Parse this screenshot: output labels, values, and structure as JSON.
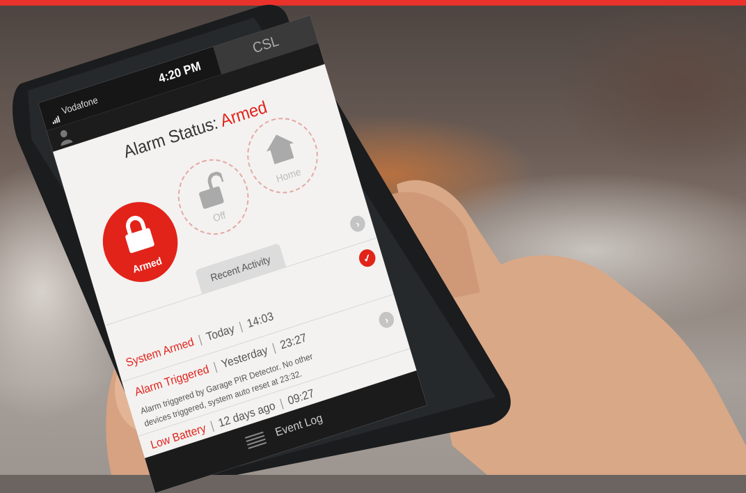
{
  "status_bar": {
    "carrier": "Vodafone",
    "time": "4:20 PM",
    "csl_tab": "CSL"
  },
  "header": {
    "title_prefix": "Alarm Status:",
    "title_value": "Armed"
  },
  "modes": [
    {
      "label": "Armed",
      "state": "active"
    },
    {
      "label": "Off",
      "state": "inactive"
    },
    {
      "label": "Home",
      "state": "inactive"
    }
  ],
  "recent_tab": "Recent Activity",
  "activity": [
    {
      "title": "System Armed",
      "day": "Today",
      "time": "14:03",
      "description": ""
    },
    {
      "title": "Alarm Triggered",
      "day": "Yesterday",
      "time": "23:27",
      "description": "Alarm triggered by Garage PIR Detector. No other devices triggered, system auto reset at 23:32."
    },
    {
      "title": "Low Battery",
      "day": "12 days ago",
      "time": "09:27",
      "description": ""
    }
  ],
  "footer": {
    "event_log": "Event Log"
  },
  "colors": {
    "accent": "#e2231a",
    "top_bar": "#e8322b",
    "phone_body": "#1a1c1e",
    "skin": "#d9a887"
  },
  "icons": [
    "signal-icon",
    "battery-icon",
    "user-icon",
    "padlock-icon",
    "unlock-icon",
    "house-icon",
    "chevron-right-icon",
    "check-icon",
    "menu-icon"
  ]
}
